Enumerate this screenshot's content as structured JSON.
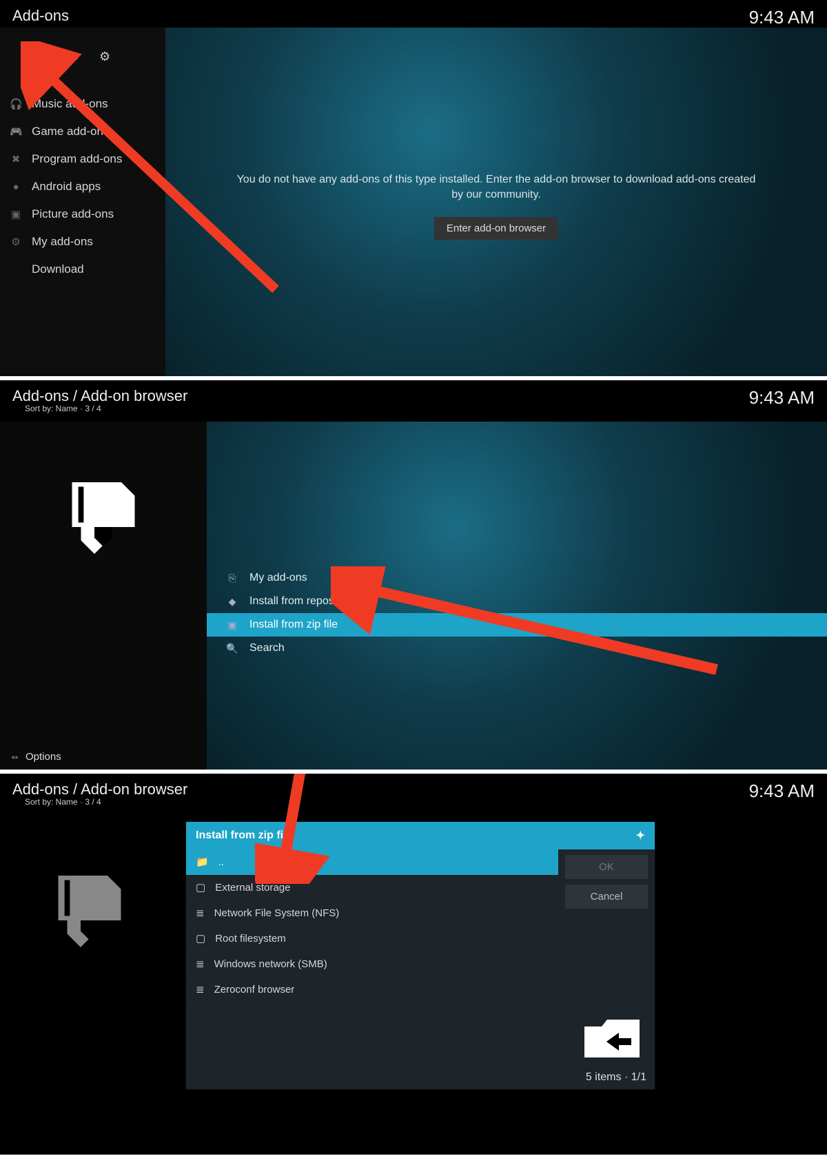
{
  "panel1": {
    "title": "Add-ons",
    "time": "9:43 AM",
    "icon_box": "box-icon",
    "refresh_count": "0",
    "sidebar_items": [
      {
        "icon": "🎧",
        "label": "Music add-ons"
      },
      {
        "icon": "🎮",
        "label": "Game add-ons"
      },
      {
        "icon": "✖",
        "label": "Program add-ons"
      },
      {
        "icon": "●",
        "label": "Android apps"
      },
      {
        "icon": "▣",
        "label": "Picture add-ons"
      },
      {
        "icon": "⚙",
        "label": "My add-ons"
      },
      {
        "icon": "",
        "label": "Download"
      }
    ],
    "message": "You do not have any add-ons of this type installed. Enter the add-on browser to download add-ons created by our community.",
    "button": "Enter add-on browser"
  },
  "panel2": {
    "title": "Add-ons / Add-on browser",
    "sort": "Sort by: Name  ·  3 / 4",
    "time": "9:43 AM",
    "list": [
      {
        "icon": "⎘",
        "label": "My add-ons",
        "active": false
      },
      {
        "icon": "◆",
        "label": "Install from repository",
        "active": false
      },
      {
        "icon": "▣",
        "label": "Install from zip file",
        "active": true
      },
      {
        "icon": "🔍",
        "label": "Search",
        "active": false
      }
    ],
    "options": "Options"
  },
  "panel3": {
    "title": "Add-ons / Add-on browser",
    "sort": "Sort by: Name  ·  3 / 4",
    "time": "9:43 AM",
    "dialog_title": "Install from zip file",
    "rows": [
      {
        "icon": "📁",
        "label": "..",
        "hi": true
      },
      {
        "icon": "▢",
        "label": "External storage",
        "hi": false
      },
      {
        "icon": "≣",
        "label": "Network File System (NFS)",
        "hi": false
      },
      {
        "icon": "▢",
        "label": "Root filesystem",
        "hi": false
      },
      {
        "icon": "≣",
        "label": "Windows network (SMB)",
        "hi": false
      },
      {
        "icon": "≣",
        "label": "Zeroconf browser",
        "hi": false
      }
    ],
    "ok": "OK",
    "cancel": "Cancel",
    "footer_count": "5",
    "footer_items": "items",
    "footer_page": "1/1"
  }
}
